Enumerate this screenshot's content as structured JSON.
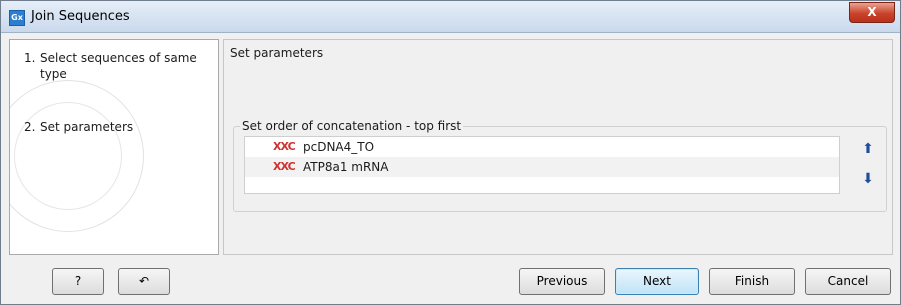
{
  "window": {
    "title": "Join Sequences",
    "icon_text": "Gx",
    "close_glyph": "X"
  },
  "steps": [
    {
      "number": "1.",
      "label": "Select sequences of same type"
    },
    {
      "number": "2.",
      "label": "Set parameters"
    }
  ],
  "panel": {
    "title": "Set parameters",
    "group_title": "Set order of concatenation - top first",
    "sequences": [
      {
        "icon": "XXC",
        "name": "pcDNA4_TO"
      },
      {
        "icon": "XXC",
        "name": "ATP8a1 mRNA"
      }
    ],
    "move_up_glyph": "⬆",
    "move_down_glyph": "⬇"
  },
  "buttons": {
    "help": "?",
    "reset_glyph": "↶",
    "previous": "Previous",
    "next": "Next",
    "finish": "Finish",
    "cancel": "Cancel"
  }
}
